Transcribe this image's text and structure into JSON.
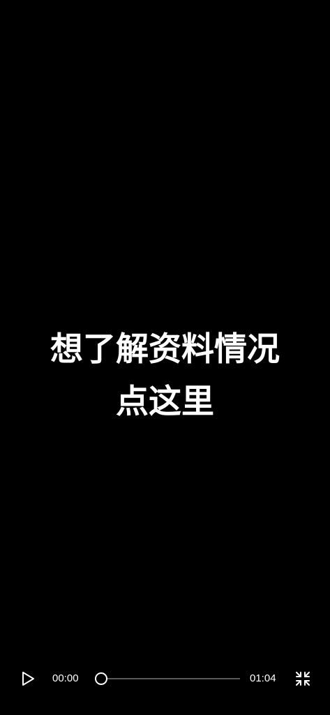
{
  "video": {
    "caption_line1": "想了解资料情况",
    "caption_line2": "点这里"
  },
  "player": {
    "current_time": "00:00",
    "total_time": "01:04",
    "progress": 0,
    "play_icon": "play-icon",
    "exit_fullscreen_icon": "exit-fullscreen-icon"
  },
  "colors": {
    "background": "#000000",
    "text": "#ffffff",
    "track": "#5a5a5a"
  }
}
